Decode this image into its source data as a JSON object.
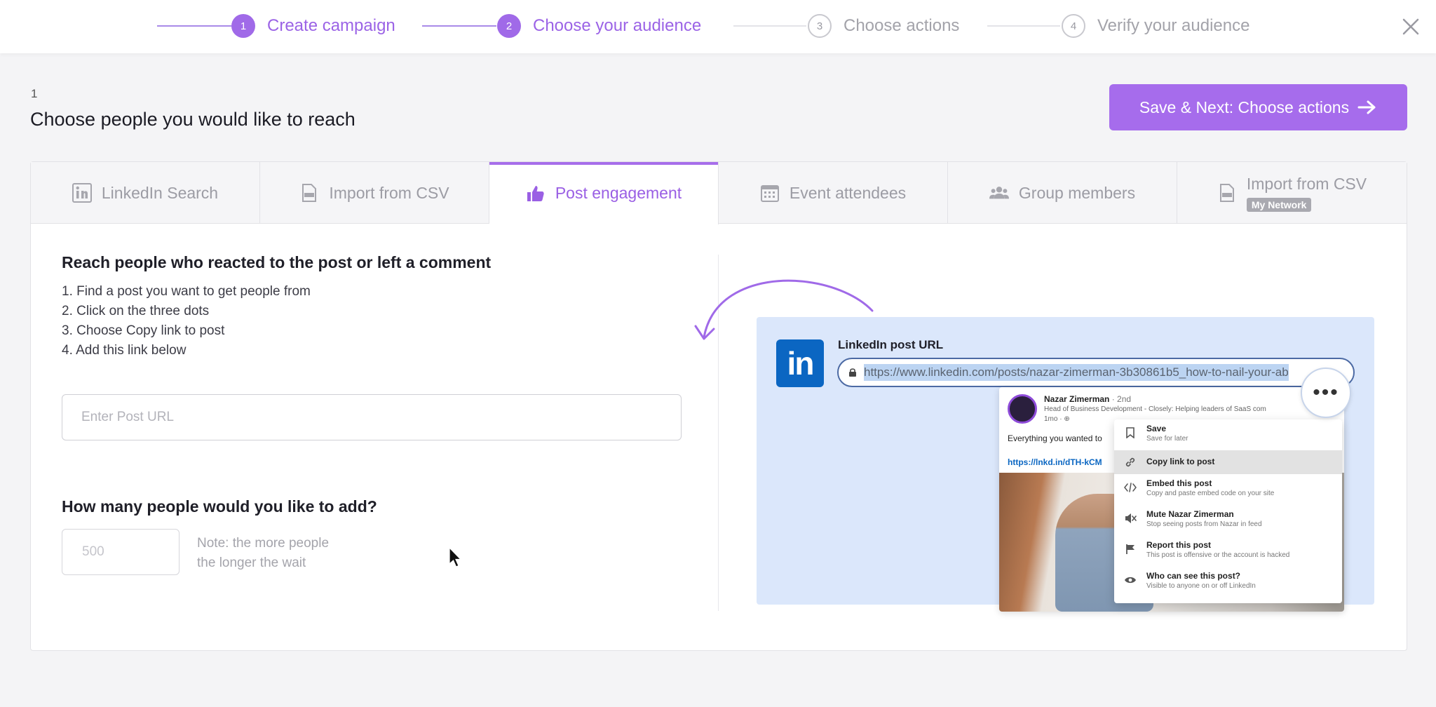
{
  "stepper": {
    "steps": [
      {
        "num": "1",
        "label": "Create campaign"
      },
      {
        "num": "2",
        "label": "Choose your audience"
      },
      {
        "num": "3",
        "label": "Choose actions"
      },
      {
        "num": "4",
        "label": "Verify your audience"
      }
    ]
  },
  "header": {
    "section_number": "1",
    "title": "Choose people you would like to reach",
    "save_button": "Save & Next: Choose actions"
  },
  "tabs": [
    {
      "label": "LinkedIn Search",
      "icon": "linkedin-icon"
    },
    {
      "label": "Import from CSV",
      "icon": "csv-file-icon"
    },
    {
      "label": "Post engagement",
      "icon": "thumbs-up-icon"
    },
    {
      "label": "Event attendees",
      "icon": "calendar-icon"
    },
    {
      "label": "Group members",
      "icon": "group-icon"
    },
    {
      "label": "Import from CSV",
      "badge": "My Network",
      "icon": "csv-file-icon"
    }
  ],
  "post_engagement": {
    "title": "Reach people who reacted to the post or left a comment",
    "instructions": [
      "1. Find a post you want to get people from",
      "2. Click on the three dots",
      "3. Choose Copy link to post",
      "4. Add this link below"
    ],
    "url_placeholder": "Enter Post URL",
    "count_title": "How many people would you like to add?",
    "count_placeholder": "500",
    "note_line1": "Note: the more people",
    "note_line2": "the longer the wait"
  },
  "illustration": {
    "logo_text": "in",
    "url_label": "LinkedIn post URL",
    "url_value": "https://www.linkedin.com/posts/nazar-zimerman-3b30861b5_how-to-nail-your-ab",
    "post": {
      "name": "Nazar Zimerman",
      "degree": "· 2nd",
      "subtitle": "Head of Business Development - Closely: Helping leaders of SaaS com",
      "time": "1mo · ⊕",
      "text": "Everything you wanted to",
      "link": "https://lnkd.in/dTH-kCM"
    },
    "dots": "•••",
    "menu": [
      {
        "title": "Save",
        "desc": "Save for later",
        "icon": "bookmark-icon"
      },
      {
        "title": "Copy link to post",
        "desc": "",
        "icon": "link-icon"
      },
      {
        "title": "Embed this post",
        "desc": "Copy and paste embed code on your site",
        "icon": "code-icon"
      },
      {
        "title": "Mute Nazar Zimerman",
        "desc": "Stop seeing posts from Nazar in feed",
        "icon": "mute-icon"
      },
      {
        "title": "Report this post",
        "desc": "This post is offensive or the account is hacked",
        "icon": "flag-icon"
      },
      {
        "title": "Who can see this post?",
        "desc": "Visible to anyone on or off LinkedIn",
        "icon": "eye-icon"
      }
    ]
  },
  "colors": {
    "accent": "#a66cec",
    "accent_text": "#9b63e6",
    "linkedin_blue": "#0b66c2",
    "illustration_bg": "#dbe7fb"
  }
}
